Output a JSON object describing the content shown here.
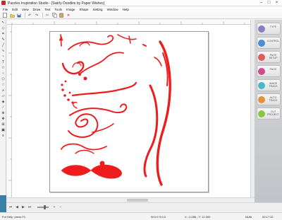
{
  "window": {
    "title": "Pazzles Inspiration Studio - [Swirly Doodles by Paper Wishes]"
  },
  "menu": [
    "File",
    "Edit",
    "View",
    "Draw",
    "Text",
    "Tools",
    "Image",
    "Shape",
    "Setting",
    "Window",
    "Help"
  ],
  "toolbar_icons": [
    "new-icon",
    "open-icon",
    "save-icon",
    "undo-icon",
    "redo-icon",
    "cut-icon",
    "copy-icon",
    "paste-icon",
    "delete-icon"
  ],
  "left_tools": [
    "pointer-icon",
    "node-icon",
    "crop-icon",
    "pen-icon",
    "line-icon",
    "curve-icon",
    "freehand-icon",
    "text-icon",
    "rectangle-icon",
    "ellipse-icon",
    "polygon-icon",
    "star-icon",
    "knife-icon",
    "eraser-icon",
    "fill-icon",
    "eyedropper-icon",
    "zoom-icon",
    "pan-icon",
    "weld-icon",
    "shadow-icon",
    "layers-icon"
  ],
  "panel": {
    "tabs": [
      {
        "label": "TYPE",
        "color": "#8a7fbf"
      },
      {
        "label": "CONTROL",
        "color": "#4a8fd6"
      },
      {
        "label": "PAGE SETUP",
        "color": "#e05b5b"
      },
      {
        "label": "PAGE",
        "color": "#d84a8e"
      },
      {
        "label": "IMAGE TRACE",
        "color": "#4ab6c9"
      },
      {
        "label": "AUTO TRACE",
        "color": "#e8913a"
      },
      {
        "label": "CUT PROJECT",
        "color": "#8cc63e"
      }
    ]
  },
  "artwork": {
    "color": "#ee1c1c",
    "description_shapes": [
      "swirl-flourish",
      "scroll-flourish",
      "dotted-flourish",
      "curl-flourish",
      "spiral-flourish",
      "leaf-flourish",
      "bow-flourish",
      "tall-flourish",
      "s-curve-flourish"
    ]
  },
  "status": {
    "help_text": "For Help, press F1",
    "dimensions": "W:0.0   H:0.0",
    "coordinates": "X: -0.286 , Y: 12.300",
    "num_indicator": "NUM",
    "time": "00:17:32"
  }
}
